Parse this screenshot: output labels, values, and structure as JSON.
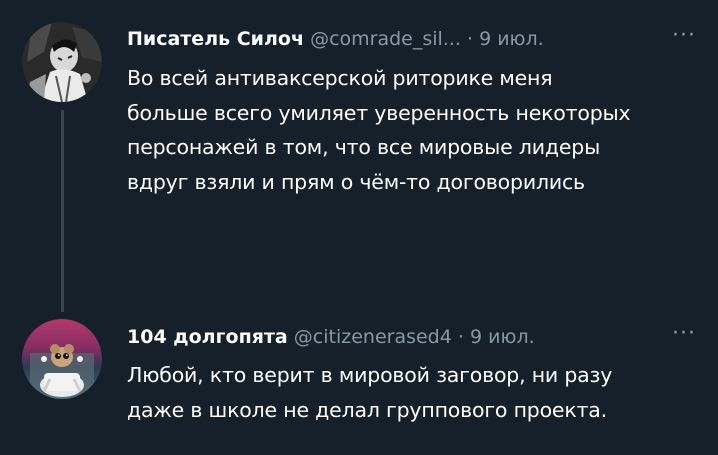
{
  "tweets": [
    {
      "author_name": "Писатель Силоч",
      "author_handle": "@comrade_sil...",
      "separator": "·",
      "time": "9 июл.",
      "more_glyph": "···",
      "text_lines": [
        "Во всей антиваксерской риторике меня",
        "больше всего умиляет уверенность некоторых",
        "персонажей в том, что все мировые лидеры",
        "вдруг взяли и прям о чём-то договорились"
      ]
    },
    {
      "author_name": "104 долгопята",
      "author_handle": "@citizenerased4",
      "separator": "·",
      "time": "9 июл.",
      "more_glyph": "···",
      "text_lines": [
        "Любой, кто верит в мировой заговор, ни разу",
        "даже в школе не делал группового проекта."
      ]
    }
  ],
  "colors": {
    "background": "#15202b",
    "text": "#ffffff",
    "secondary": "#8899a6",
    "thread_line": "#38444d"
  }
}
